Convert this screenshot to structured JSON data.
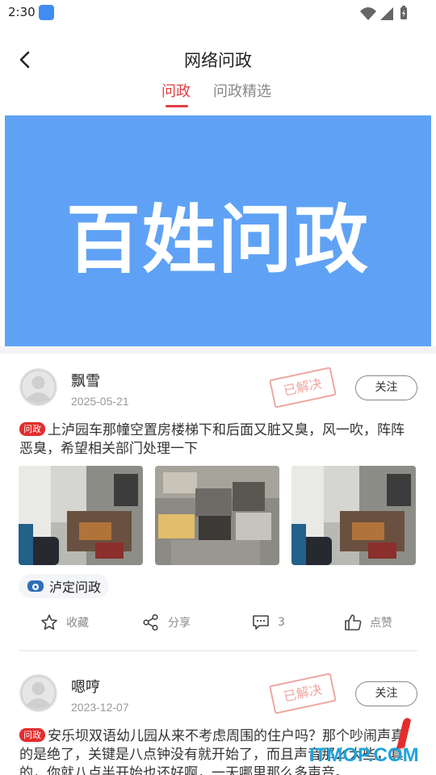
{
  "status_bar": {
    "time": "2:30"
  },
  "header": {
    "title": "网络问政"
  },
  "tabs": [
    {
      "label": "问政"
    },
    {
      "label": "问政精选"
    }
  ],
  "banner": {
    "text": "百姓问政",
    "color": "#5fa2f5"
  },
  "posts": [
    {
      "author": "飘雪",
      "date": "2025-05-21",
      "status": "已解决",
      "follow_label": "关注",
      "tag": "问政",
      "content": "上泸园车那幢空置房楼梯下和后面又脏又臭，风一吹，阵阵恶臭，希望相关部门处理一下",
      "channel": "泸定问政",
      "actions": {
        "collect": "收藏",
        "share": "分享",
        "comments": "3",
        "like": "点赞"
      }
    },
    {
      "author": "嗯哼",
      "date": "2023-12-07",
      "status": "已解决",
      "follow_label": "关注",
      "tag": "问政",
      "content": "安乐坝双语幼儿园从来不考虑周围的住户吗？那个吵闹声真的是绝了，关键是八点钟没有就开始了，而且声音那么大些，真的，你就八点半开始也还好啊，一天哪里那么多声音。"
    }
  ],
  "watermark": {
    "text": "ITMOP.COM"
  },
  "colors": {
    "accent": "#e23e42",
    "tag_bg": "#e32d2d",
    "stamp": "#e98a84"
  }
}
